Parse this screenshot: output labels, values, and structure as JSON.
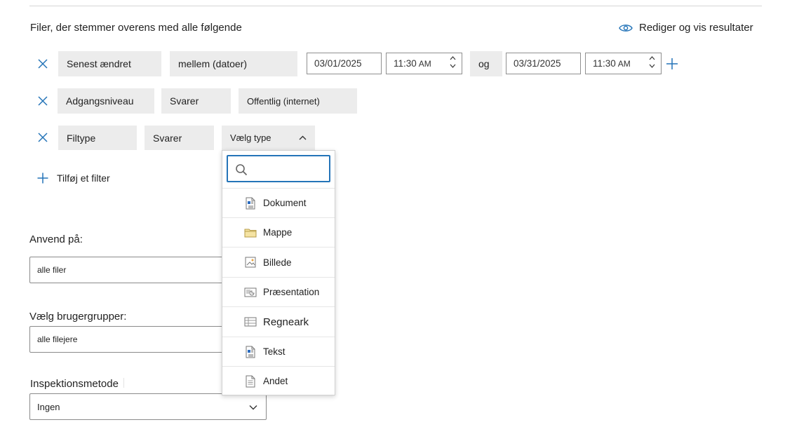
{
  "filters": {
    "heading": "Filer, der stemmer overens med alle følgende",
    "edit_results": "Rediger og vis resultater",
    "rows": [
      {
        "field": "Senest ændret",
        "operator": "mellem (datoer)",
        "from_date": "03/01/2025",
        "from_time": "11:30",
        "from_ampm": "AM",
        "connector": "og",
        "to_date": "03/31/2025",
        "to_time": "11:30",
        "to_ampm": "AM"
      },
      {
        "field": "Adgangsniveau",
        "operator": "Svarer",
        "value": "Offentlig (internet)"
      },
      {
        "field": "Filtype",
        "operator": "Svarer",
        "value": "Vælg type"
      }
    ],
    "add_filter": "Tilføj et filter"
  },
  "file_type_dropdown": {
    "search_placeholder": "",
    "items": [
      {
        "label": "Dokument",
        "icon": "document-icon"
      },
      {
        "label": "Mappe",
        "icon": "folder-icon"
      },
      {
        "label": "Billede",
        "icon": "image-icon"
      },
      {
        "label": "Præsentation",
        "icon": "presentation-icon"
      },
      {
        "label": "Regneark",
        "icon": "spreadsheet-icon"
      },
      {
        "label": "Tekst",
        "icon": "text-file-icon"
      },
      {
        "label": "Andet",
        "icon": "generic-file-icon"
      }
    ]
  },
  "apply_to": {
    "label": "Anvend på:",
    "value": "alle filer"
  },
  "user_groups": {
    "label": "Vælg brugergrupper:",
    "value": "alle filejere"
  },
  "inspection": {
    "label": "Inspektionsmetode",
    "value": "Ingen"
  },
  "colors": {
    "accent": "#2474b8",
    "chip": "#ececec",
    "border": "#8f8f8f"
  }
}
